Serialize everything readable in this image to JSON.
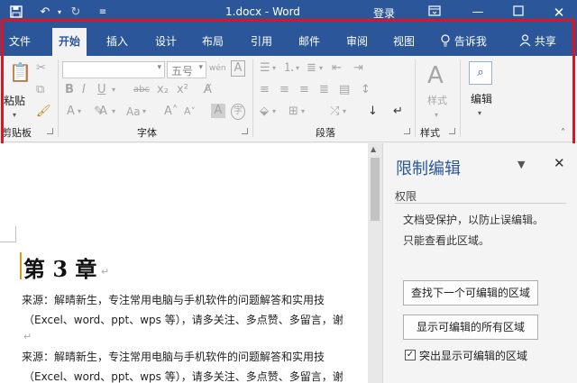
{
  "titlebar": {
    "save_icon": "save-icon",
    "undo_icon": "undo-icon",
    "redo_icon": "redo-icon",
    "customize_icon": "customize-qat-icon",
    "title": "1.docx - Word",
    "login": "登录",
    "ribbon_display_icon": "ribbon-display-options-icon",
    "minimize_icon": "minimize-icon",
    "maximize_icon": "maximize-icon",
    "close_icon": "close-icon"
  },
  "tabs": [
    "文件",
    "开始",
    "插入",
    "设计",
    "布局",
    "引用",
    "邮件",
    "审阅",
    "视图"
  ],
  "active_tab": "开始",
  "tell_me": "告诉我",
  "share": "共享",
  "ribbon": {
    "clipboard": {
      "paste": "粘贴",
      "label": "剪贴板"
    },
    "font": {
      "font_name": "",
      "font_size": "五号",
      "label": "字体"
    },
    "paragraph": {
      "label": "段落"
    },
    "styles": {
      "button": "样式",
      "label": "样式"
    },
    "editing": {
      "button": "编辑"
    }
  },
  "document": {
    "chapter": "第 3 章",
    "paragraphs": [
      {
        "line1": "来源：解晴新生，专注常用电脑与手机软件的问题解答和实用技",
        "line2": "（Excel、word、ppt、wps 等），请多关注、多点赞、多留言，谢"
      },
      {
        "line1": "来源：解晴新生，专注常用电脑与手机软件的问题解答和实用技",
        "line2": "（Excel、word、ppt、wps 等），请多关注、多点赞、多留言，谢"
      }
    ],
    "return_mark": "↵"
  },
  "restrict_pane": {
    "title": "限制编辑",
    "section": "权限",
    "message_line1": "文档受保护，以防止误编辑。",
    "message_line2": "只能查看此区域。",
    "find_next_button": "查找下一个可编辑的区域",
    "show_all_button": "显示可编辑的所有区域",
    "highlight_checkbox_label": "突出显示可编辑的区域",
    "highlight_checked": true,
    "checkmark": "✓"
  },
  "colors": {
    "accent": "#2b579a",
    "highlight_box": "#e0141e"
  }
}
